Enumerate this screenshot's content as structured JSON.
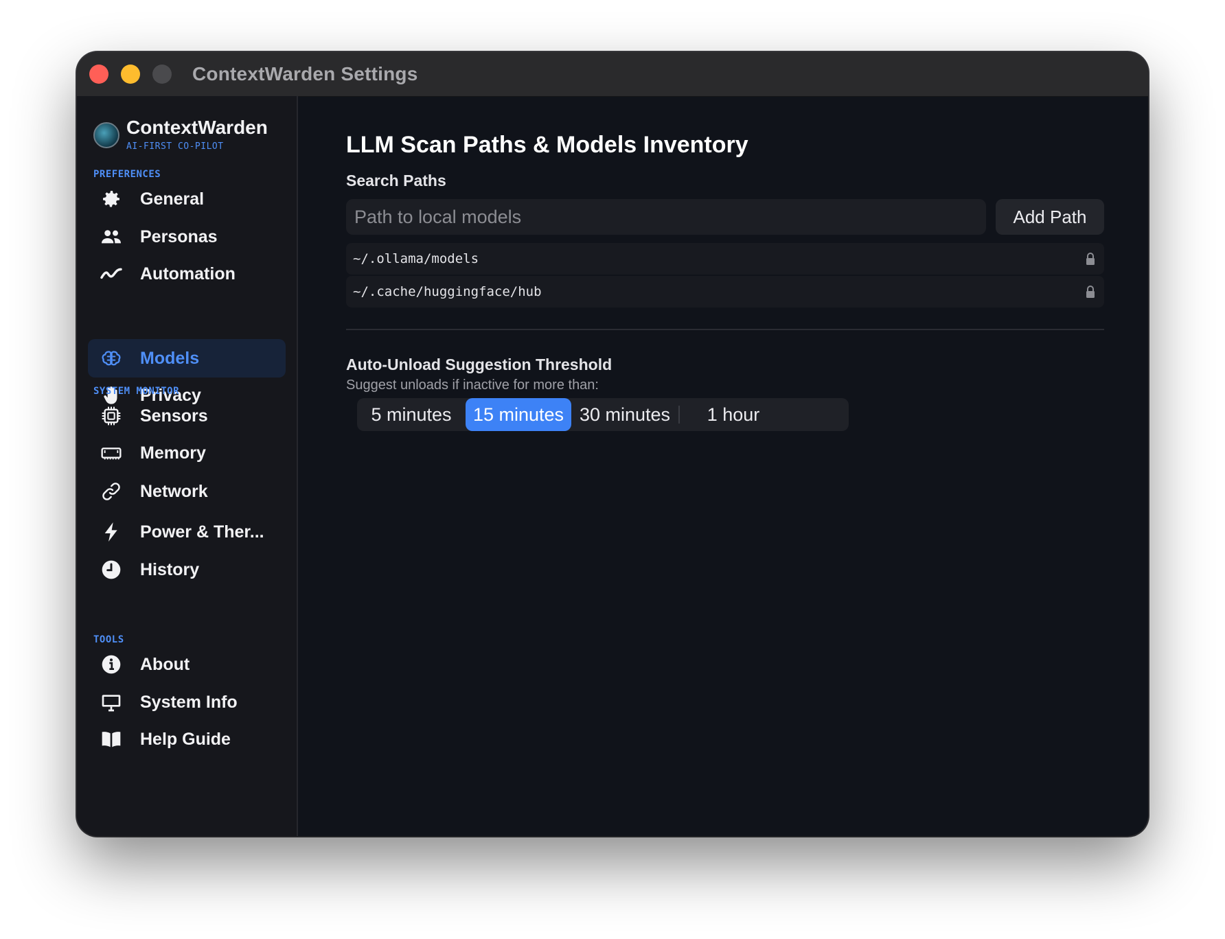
{
  "window": {
    "title": "ContextWarden Settings"
  },
  "brand": {
    "name": "ContextWarden",
    "tagline": "AI-FIRST CO-PILOT"
  },
  "sidebar": {
    "sections": [
      {
        "label": "PREFERENCES",
        "items": [
          {
            "label": "General",
            "icon": "gear-icon"
          },
          {
            "label": "Personas",
            "icon": "people-icon"
          },
          {
            "label": "Automation",
            "icon": "wave-icon"
          },
          {
            "label": "Models",
            "icon": "brain-icon",
            "active": true
          },
          {
            "label": "Privacy",
            "icon": "hand-icon"
          }
        ]
      },
      {
        "label": "SYSTEM MONITOR",
        "items": [
          {
            "label": "Sensors",
            "icon": "chip-icon"
          },
          {
            "label": "Memory",
            "icon": "memory-icon"
          },
          {
            "label": "Network",
            "icon": "link-icon"
          },
          {
            "label": "Power & Ther...",
            "icon": "bolt-icon"
          },
          {
            "label": "History",
            "icon": "clock-icon"
          }
        ]
      },
      {
        "label": "TOOLS",
        "items": [
          {
            "label": "About",
            "icon": "info-icon"
          },
          {
            "label": "System Info",
            "icon": "monitor-icon"
          },
          {
            "label": "Help Guide",
            "icon": "book-icon"
          }
        ]
      }
    ]
  },
  "main": {
    "title": "LLM Scan Paths & Models Inventory",
    "search_paths": {
      "heading": "Search Paths",
      "input_placeholder": "Path to local models",
      "input_value": "",
      "add_button": "Add Path",
      "paths": [
        "~/.ollama/models",
        "~/.cache/huggingface/hub"
      ]
    },
    "threshold": {
      "heading": "Auto-Unload Suggestion Threshold",
      "hint": "Suggest unloads if inactive for more than:",
      "options": [
        "5 minutes",
        "15 minutes",
        "30 minutes",
        "1 hour"
      ],
      "selected": "15 minutes"
    }
  },
  "colors": {
    "accent": "#3d82f6",
    "accent_text": "#4f8ff7",
    "background": "#10131a",
    "sidebar": "#16171c"
  }
}
